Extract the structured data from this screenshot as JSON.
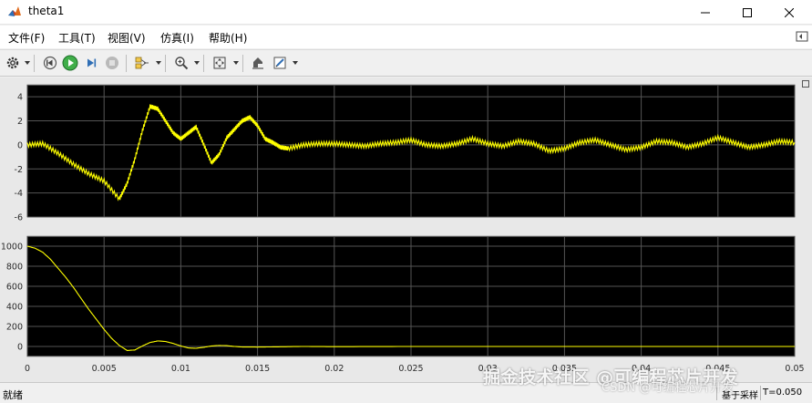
{
  "window": {
    "title": "theta1",
    "accent_color": "#e8e8e8"
  },
  "menu": {
    "items": [
      "文件(F)",
      "工具(T)",
      "视图(V)",
      "仿真(I)",
      "帮助(H)"
    ]
  },
  "toolbar": {
    "buttons": [
      {
        "icon": "gear-icon"
      },
      {
        "icon": "step-back-icon"
      },
      {
        "icon": "run-icon"
      },
      {
        "icon": "step-forward-icon"
      },
      {
        "icon": "stop-icon"
      },
      {
        "icon": "highlight-icon"
      },
      {
        "icon": "zoom-in-icon"
      },
      {
        "icon": "fit-to-view-icon"
      },
      {
        "icon": "cursor-measure-icon"
      },
      {
        "icon": "edit-icon"
      }
    ]
  },
  "status": {
    "left_text": "就绪",
    "mode_text": "基于采样",
    "time_text": "T=0.050"
  },
  "watermark": {
    "line1": "掘金技术社区 @可编程芯片开发",
    "line2": "CSDN @可编程芯片开发"
  },
  "chart_data": [
    {
      "type": "line",
      "title": "",
      "xlabel": "",
      "ylabel": "",
      "xlim": [
        0,
        0.05
      ],
      "ylim": [
        -6,
        5
      ],
      "yticks": [
        -6,
        -4,
        -2,
        0,
        2,
        4
      ],
      "grid": true,
      "background": "#000000",
      "line_color": "#ffff00",
      "series": [
        {
          "x": [
            0,
            0.001,
            0.002,
            0.003,
            0.004,
            0.005,
            0.006,
            0.0065,
            0.007,
            0.0075,
            0.008,
            0.0085,
            0.009,
            0.0095,
            0.01,
            0.0105,
            0.011,
            0.0115,
            0.012,
            0.0125,
            0.013,
            0.0135,
            0.014,
            0.0145,
            0.015,
            0.0155,
            0.016,
            0.0165,
            0.017,
            0.018,
            0.019,
            0.02,
            0.021,
            0.022,
            0.023,
            0.024,
            0.025,
            0.026,
            0.027,
            0.028,
            0.029,
            0.03,
            0.031,
            0.032,
            0.033,
            0.034,
            0.035,
            0.036,
            0.037,
            0.038,
            0.039,
            0.04,
            0.041,
            0.042,
            0.043,
            0.044,
            0.045,
            0.046,
            0.047,
            0.048,
            0.049,
            0.05
          ],
          "y": [
            0.0,
            0.1,
            -0.7,
            -1.6,
            -2.4,
            -3.0,
            -4.5,
            -3.2,
            -1.2,
            1.2,
            3.2,
            3.0,
            2.0,
            1.0,
            0.5,
            1.0,
            1.5,
            0.0,
            -1.5,
            -0.8,
            0.6,
            1.3,
            2.0,
            2.3,
            1.6,
            0.5,
            0.2,
            -0.2,
            -0.3,
            0.0,
            0.1,
            0.1,
            0.0,
            -0.1,
            0.1,
            0.2,
            0.4,
            0.0,
            -0.1,
            0.1,
            0.5,
            0.1,
            -0.1,
            0.3,
            0.1,
            -0.5,
            -0.3,
            0.2,
            0.4,
            0.0,
            -0.4,
            -0.2,
            0.3,
            0.2,
            -0.2,
            0.1,
            0.6,
            0.2,
            -0.2,
            0.0,
            0.3,
            0.2
          ]
        }
      ]
    },
    {
      "type": "line",
      "title": "",
      "xlabel": "",
      "ylabel": "",
      "xlim": [
        0,
        0.05
      ],
      "ylim": [
        -100,
        1100
      ],
      "yticks": [
        0,
        200,
        400,
        600,
        800,
        1000
      ],
      "xticks": [
        0,
        0.005,
        0.01,
        0.015,
        0.02,
        0.025,
        0.03,
        0.035,
        0.04,
        0.045,
        0.05
      ],
      "xtick_labels": [
        "0",
        "0.005",
        "0.01",
        "0.015",
        "0.02",
        "0.025",
        "0.03",
        "0.035",
        "0.04",
        "0.045",
        "0.05"
      ],
      "grid": true,
      "background": "#000000",
      "line_color": "#ffff00",
      "series": [
        {
          "x": [
            0,
            0.0005,
            0.001,
            0.0015,
            0.002,
            0.0025,
            0.003,
            0.0035,
            0.004,
            0.0045,
            0.005,
            0.0055,
            0.006,
            0.0065,
            0.007,
            0.0075,
            0.008,
            0.0085,
            0.009,
            0.0095,
            0.01,
            0.0105,
            0.011,
            0.0115,
            0.012,
            0.0125,
            0.013,
            0.0135,
            0.014,
            0.015,
            0.016,
            0.018,
            0.02,
            0.025,
            0.03,
            0.035,
            0.04,
            0.045,
            0.05
          ],
          "y": [
            1000,
            980,
            940,
            870,
            780,
            690,
            590,
            480,
            370,
            270,
            170,
            80,
            10,
            -40,
            -35,
            5,
            40,
            55,
            50,
            30,
            5,
            -15,
            -18,
            -8,
            5,
            10,
            8,
            0,
            -5,
            -6,
            -4,
            0,
            -2,
            0,
            0,
            0,
            0,
            0,
            0
          ]
        }
      ]
    }
  ]
}
